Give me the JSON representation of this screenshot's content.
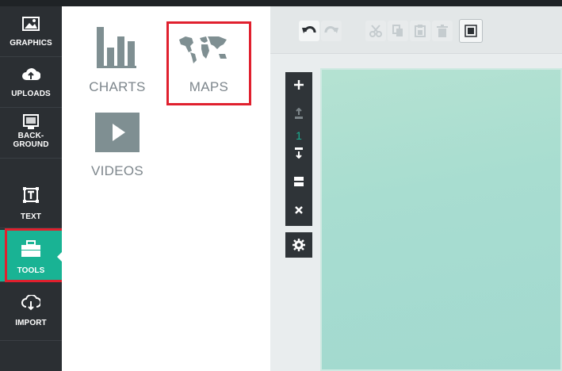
{
  "sidebar": {
    "items": [
      {
        "label": "GRAPHICS",
        "icon": "picture-icon"
      },
      {
        "label": "UPLOADS",
        "icon": "cloud-upload-icon"
      },
      {
        "label": "BACK-",
        "label2": "GROUND",
        "icon": "background-icon"
      },
      {
        "label": "TEXT",
        "icon": "text-box-icon"
      },
      {
        "label": "TOOLS",
        "icon": "toolbox-icon",
        "active": true
      },
      {
        "label": "IMPORT",
        "icon": "cloud-download-icon"
      }
    ],
    "active_color": "#19b394",
    "highlight_color": "#e0202e"
  },
  "panel": {
    "tiles": [
      {
        "label": "CHARTS",
        "icon": "bar-chart-icon"
      },
      {
        "label": "MAPS",
        "icon": "world-map-icon",
        "highlighted": true
      },
      {
        "label": "VIDEOS",
        "icon": "play-icon"
      }
    ]
  },
  "toolbar": {
    "buttons": [
      "undo-icon",
      "redo-icon",
      "cut-icon",
      "copy-icon",
      "paste-icon",
      "delete-icon",
      "layer-icon"
    ]
  },
  "page_tools": {
    "page_number": "1",
    "buttons": [
      "add-page-icon",
      "move-up-icon",
      "move-down-icon",
      "duplicate-icon",
      "close-icon",
      "settings-icon"
    ]
  },
  "canvas": {
    "background": "#a8ddd0"
  }
}
